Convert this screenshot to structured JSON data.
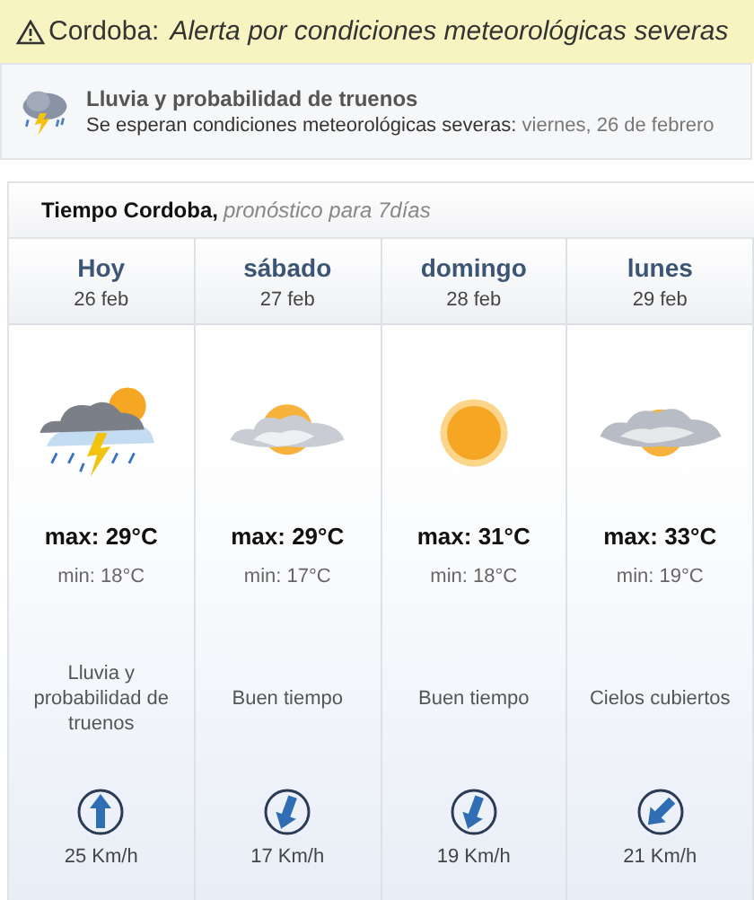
{
  "alert": {
    "place": "Cordoba:",
    "message": "Alerta por condiciones meteorológicas severas"
  },
  "warning": {
    "title": "Lluvia y probabilidad de truenos",
    "text": "Se esperan condiciones meteorológicas severas:",
    "date": "viernes, 26 de febrero"
  },
  "forecast": {
    "title": "Tiempo Cordoba,",
    "subtitle": "pronóstico para 7días",
    "days": [
      {
        "day": "Hoy",
        "date": "26 feb",
        "kind": "storm",
        "max": "max: 29°C",
        "min": "min: 18°C",
        "description": "Lluvia y probabilidad de truenos",
        "wind": {
          "kind": "north",
          "speed": "25 Km/h"
        }
      },
      {
        "day": "sábado",
        "date": "27 feb",
        "kind": "partly-cloudy",
        "max": "max: 29°C",
        "min": "min: 17°C",
        "description": "Buen tiempo",
        "wind": {
          "kind": "south",
          "speed": "17 Km/h"
        }
      },
      {
        "day": "domingo",
        "date": "28 feb",
        "kind": "sunny",
        "max": "max: 31°C",
        "min": "min: 18°C",
        "description": "Buen tiempo",
        "wind": {
          "kind": "south",
          "speed": "19 Km/h"
        }
      },
      {
        "day": "lunes",
        "date": "29 feb",
        "kind": "cloudy",
        "max": "max: 33°C",
        "min": "min: 19°C",
        "description": "Cielos cubiertos",
        "wind": {
          "kind": "southwest",
          "speed": "21 Km/h"
        }
      }
    ]
  }
}
